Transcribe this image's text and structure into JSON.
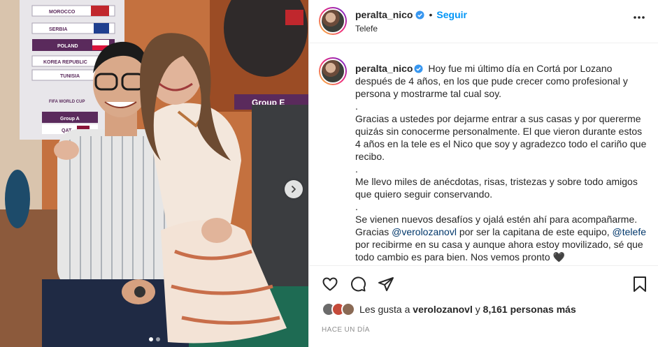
{
  "post": {
    "username": "peralta_nico",
    "follow_label": "Seguir",
    "separator": "•",
    "location": "Telefe",
    "caption": [
      "Hoy fue mi último día en Cortá por Lozano después de 4 años, en los que pude crecer como profesional y persona y mostrarme tal cual soy.",
      ".",
      "Gracias a ustedes por dejarme entrar a sus casas y por quererme quizás sin conocerme personalmente. El que vieron durante estos 4 años en la tele es el Nico que soy y agradezco todo el cariño que recibo.",
      ".",
      "Me llevo miles de anécdotas, risas, tristezas y sobre todo amigos que quiero seguir conservando.",
      ".",
      "Se vienen nuevos desafíos y ojalá estén ahí para acompañarme."
    ],
    "caption_last": {
      "p1": "Gracias ",
      "mention1": "@verolozanovl",
      "p2": " por ser la capitana de este equipo, ",
      "mention2": "@telefe",
      "p3": " por recibirme en su casa y aunque ahora estoy movilizado, sé que todo cambio es para bien. Nos vemos pronto 🖤"
    },
    "likes": {
      "prefix": "Les gusta a",
      "user": "verolozanovl",
      "connector": "y",
      "count": "8,161 personas más"
    },
    "time": "HACE UN DÍA"
  },
  "media": {
    "board_rows": [
      "MOROCCO",
      "SERBIA",
      "POLAND",
      "KOREA REPUBLIC",
      "TUNISIA"
    ],
    "cup_label": "FIFA WORLD CUP",
    "group_a": "Group A",
    "team_code": "QAT",
    "group_e": "Group E"
  },
  "icons": {
    "verified": "verified-badge-icon",
    "more": "more-options-icon",
    "heart": "heart-icon",
    "comment": "comment-icon",
    "share": "share-icon",
    "save": "bookmark-icon",
    "next": "chevron-right-icon"
  },
  "colors": {
    "link": "#0095f6",
    "mention": "#00376b",
    "verified": "#3897f0"
  }
}
